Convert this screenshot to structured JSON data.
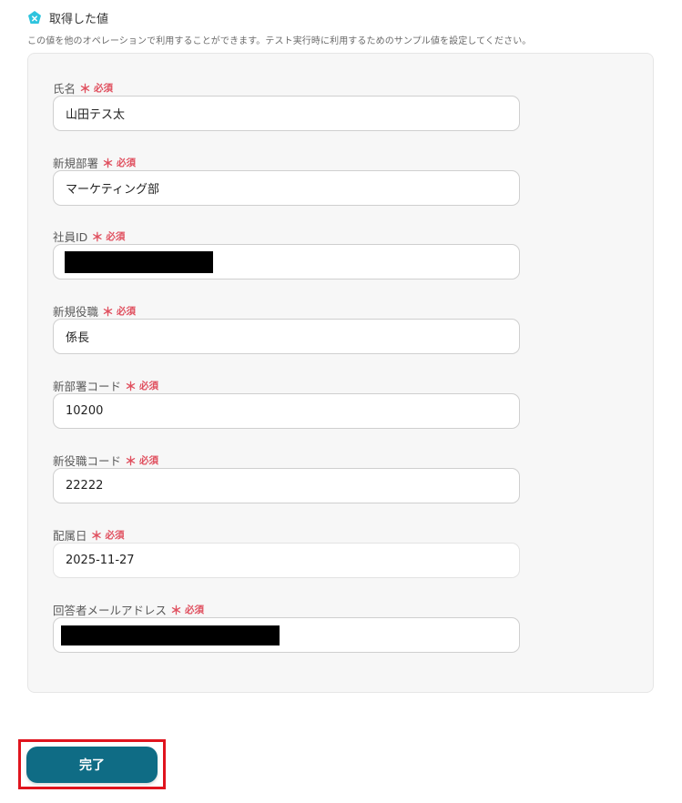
{
  "section": {
    "icon": "pentagon-x-icon",
    "icon_color": "#2ec4de",
    "title": "取得した値",
    "description": "この値を他のオペレーションで利用することができます。テスト実行時に利用するためのサンプル値を設定してください。"
  },
  "required_mark": "＊",
  "required_text": "必須",
  "fields": [
    {
      "label": "氏名",
      "value": "山田テス太"
    },
    {
      "label": "新規部署",
      "value": "マーケティング部"
    },
    {
      "label": "社員ID",
      "value": ""
    },
    {
      "label": "新規役職",
      "value": "係長"
    },
    {
      "label": "新部署コード",
      "value": "10200"
    },
    {
      "label": "新役職コード",
      "value": "22222"
    },
    {
      "label": "配属日",
      "value": "2025-11-27"
    },
    {
      "label": "回答者メールアドレス",
      "value": ""
    }
  ],
  "actions": {
    "done_label": "完了",
    "accent_color": "#0f6c85",
    "highlight_color": "#e0141e"
  }
}
